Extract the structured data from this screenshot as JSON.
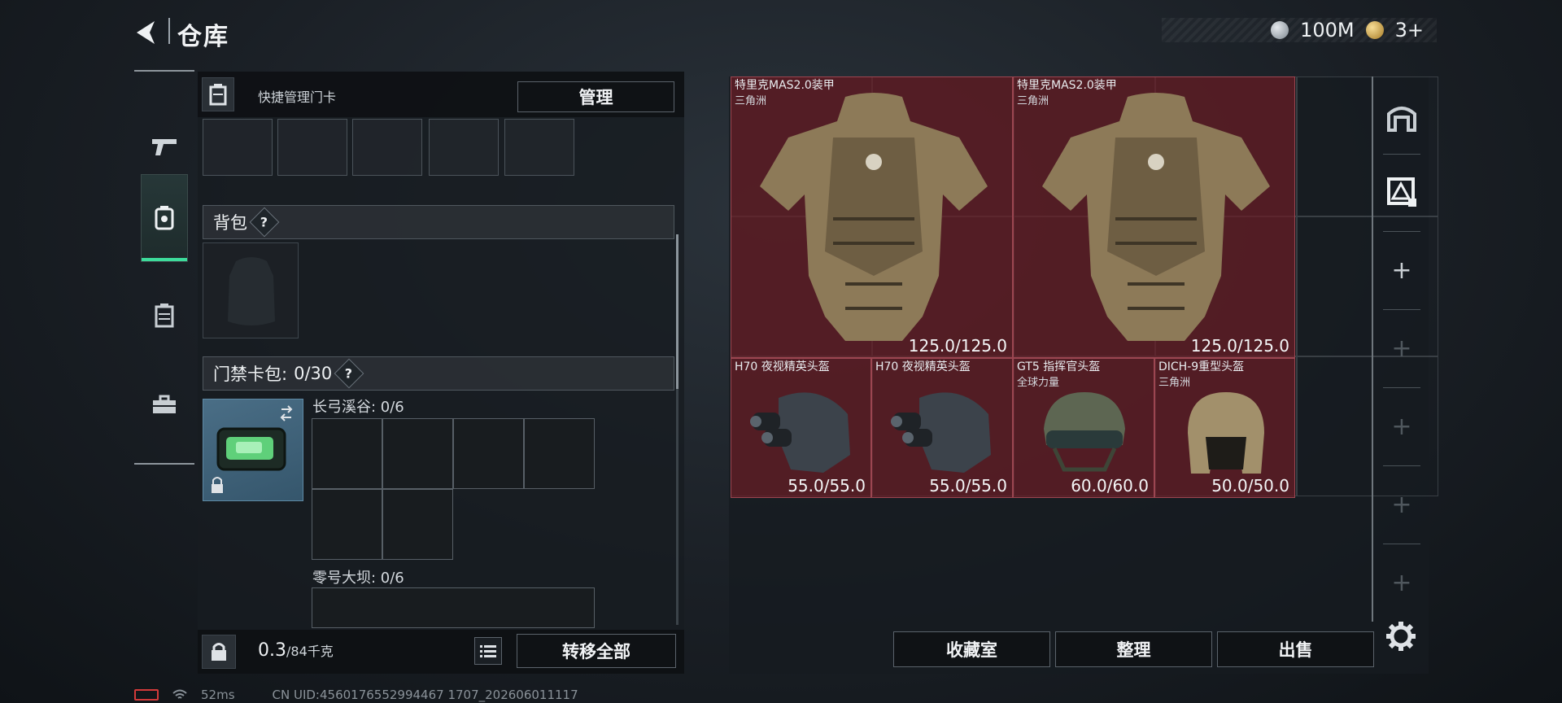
{
  "header": {
    "title": "仓库",
    "currency_amount": "100M",
    "gold_amount": "3+"
  },
  "left_nav": {
    "items": [
      {
        "name": "weapons",
        "icon": "pistol-icon"
      },
      {
        "name": "equipment",
        "icon": "backpack-gear-icon",
        "active": true
      },
      {
        "name": "cases",
        "icon": "case-icon"
      },
      {
        "name": "toolbox",
        "icon": "toolbox-icon"
      }
    ]
  },
  "left_panel": {
    "card_header_label": "快捷管理门卡",
    "manage_label": "管理",
    "backpack_label": "背包",
    "help_symbol": "?",
    "keycard_label": "门禁卡包:",
    "keycard_count": "0/30",
    "grid1_label": "长弓溪谷: 0/6",
    "grid2_label": "零号大坝: 0/6",
    "weight_value": "0.3",
    "weight_unit": "/84千克",
    "transfer_label": "转移全部"
  },
  "stash_items": [
    {
      "name": "特里克MAS2.0装甲",
      "sub": "三角洲",
      "durability": "125.0/125.0",
      "type": "armor"
    },
    {
      "name": "特里克MAS2.0装甲",
      "sub": "三角洲",
      "durability": "125.0/125.0",
      "type": "armor"
    },
    {
      "name": "H70 夜视精英头盔",
      "sub": "",
      "durability": "55.0/55.0",
      "type": "helmet-nv"
    },
    {
      "name": "H70 夜视精英头盔",
      "sub": "",
      "durability": "55.0/55.0",
      "type": "helmet-nv"
    },
    {
      "name": "GT5 指挥官头盔",
      "sub": "全球力量",
      "durability": "60.0/60.0",
      "type": "helmet-gt5"
    },
    {
      "name": "DICH-9重型头盔",
      "sub": "三角洲",
      "durability": "50.0/50.0",
      "type": "helmet-heavy"
    }
  ],
  "bottom_buttons": {
    "collection": "收藏室",
    "sort": "整理",
    "sell": "出售"
  },
  "status_bar": {
    "ping": "52ms",
    "uid": "CN UID:4560176552994467 1707_202606011117"
  },
  "colors": {
    "accent_green": "#3ddc9b",
    "item_bg": "#6a1d26",
    "panel_bg": "#171c21"
  }
}
